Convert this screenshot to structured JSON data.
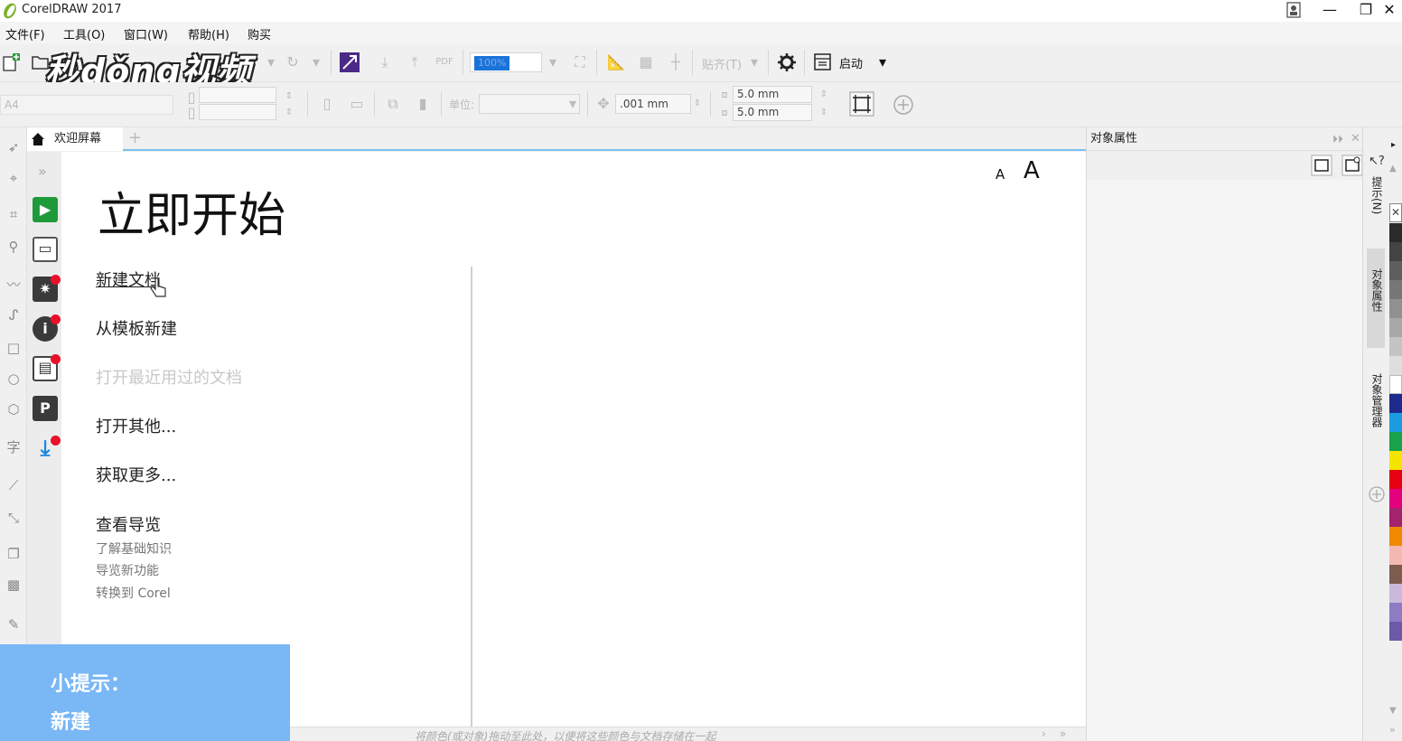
{
  "window": {
    "title": "CorelDRAW 2017",
    "minimize": "—",
    "restore": "❐",
    "close": "✕"
  },
  "menu": {
    "items": [
      "文件(F)",
      "工具(O)",
      "窗口(W)",
      "帮助(H)",
      "购买"
    ]
  },
  "watermark": {
    "text": "秒dǒng视频"
  },
  "toolbar1": {
    "zoom_value": "100%",
    "snap_label": "贴齐(T)",
    "launch_label": "启动"
  },
  "toolbar2": {
    "page_size": "A4",
    "unit_label": "单位:",
    "nudge_value": ".001 mm",
    "dup_x": "5.0 mm",
    "dup_y": "5.0 mm"
  },
  "tabs": {
    "welcome_label": "欢迎屏幕",
    "add_label": "+"
  },
  "welcome": {
    "title": "立即开始",
    "font_small": "A",
    "font_large": "A",
    "links": {
      "new_document": "新建文档",
      "new_from_template": "从模板新建",
      "open_recent": "打开最近用过的文档",
      "open_other": "打开其他...",
      "get_more": "获取更多..."
    },
    "tour": {
      "title": "查看导览",
      "items": [
        "了解基础知识",
        "导览新功能",
        "转换到 Corel"
      ]
    }
  },
  "tip": {
    "line1": "小提示：",
    "line2": "新建"
  },
  "status": {
    "text": "将颜色(或对象)拖动至此处，以便将这些颜色与文档存储在一起"
  },
  "docker": {
    "title": "对象属性"
  },
  "vtabs": {
    "hints": "提示(N)",
    "object_properties": "对象属性",
    "object_manager": "对象管理器"
  },
  "palette": {
    "colors": [
      "#2b2b2b",
      "#444444",
      "#5e5e5e",
      "#777777",
      "#909090",
      "#a8a8a8",
      "#c4c4c4",
      "#dedede",
      "#ffffff",
      "#1d2b8c",
      "#1b9be0",
      "#17a34a",
      "#f5e400",
      "#e60012",
      "#e4007f",
      "#a3246c",
      "#f08a00",
      "#f4b8b2",
      "#7d5c4e",
      "#c9b9db",
      "#8e7cc3",
      "#6a5aa8"
    ]
  },
  "colors": {
    "accent": "#7ac0ee",
    "tip_bg": "#79b7f5"
  }
}
